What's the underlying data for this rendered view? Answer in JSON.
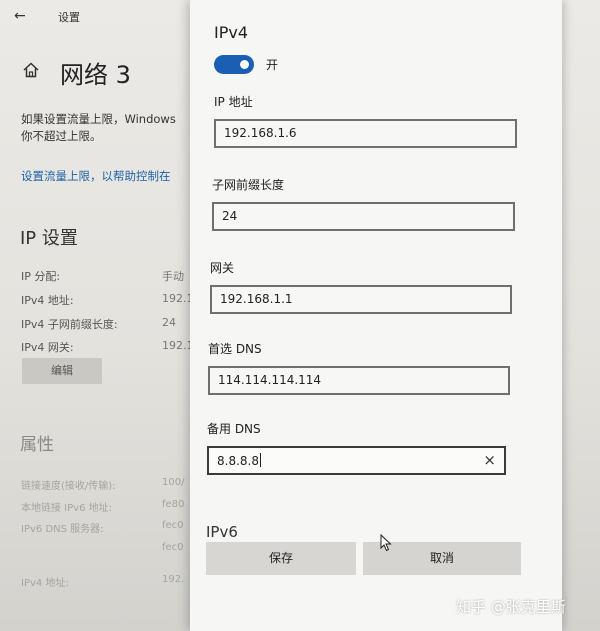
{
  "window": {
    "back_glyph": "←",
    "title": "设置"
  },
  "page": {
    "title": "网络 3",
    "description": "如果设置流量上限，Windows\n你不超过上限。",
    "metered_link": "设置流量上限，以帮助控制在"
  },
  "ip_settings": {
    "heading": "IP 设置",
    "rows": [
      {
        "label": "IP 分配:",
        "value": "手动"
      },
      {
        "label": "IPv4 地址:",
        "value": "192.1"
      },
      {
        "label": "IPv4 子网前缀长度:",
        "value": "24"
      },
      {
        "label": "IPv4 网关:",
        "value": "192.1"
      }
    ],
    "edit_button": "编辑"
  },
  "properties": {
    "heading": "属性",
    "rows": [
      {
        "label": "链接速度(接收/传输):",
        "value": "100/"
      },
      {
        "label": "本地链接 IPv6 地址:",
        "value": "fe80"
      },
      {
        "label": "IPv6 DNS 服务器:",
        "value": "fec0"
      },
      {
        "label": "",
        "value": "fec0"
      },
      {
        "label": "IPv4 地址:",
        "value": "192."
      }
    ]
  },
  "dialog": {
    "title": "IPv4",
    "toggle_label": "开",
    "toggle_on": true,
    "fields": {
      "ip_label": "IP 地址",
      "ip_value": "192.168.1.6",
      "prefix_label": "子网前缀长度",
      "prefix_value": "24",
      "gateway_label": "网关",
      "gateway_value": "192.168.1.1",
      "dns1_label": "首选 DNS",
      "dns1_value": "114.114.114.114",
      "dns2_label": "备用 DNS",
      "dns2_value": "8.8.8.8"
    },
    "clear_glyph": "×",
    "ipv6_heading": "IPv6",
    "save_button": "保存",
    "cancel_button": "取消"
  },
  "watermark": "知乎 @张克里斯",
  "colors": {
    "accent": "#1a5fb4",
    "link": "#1e61a8"
  }
}
